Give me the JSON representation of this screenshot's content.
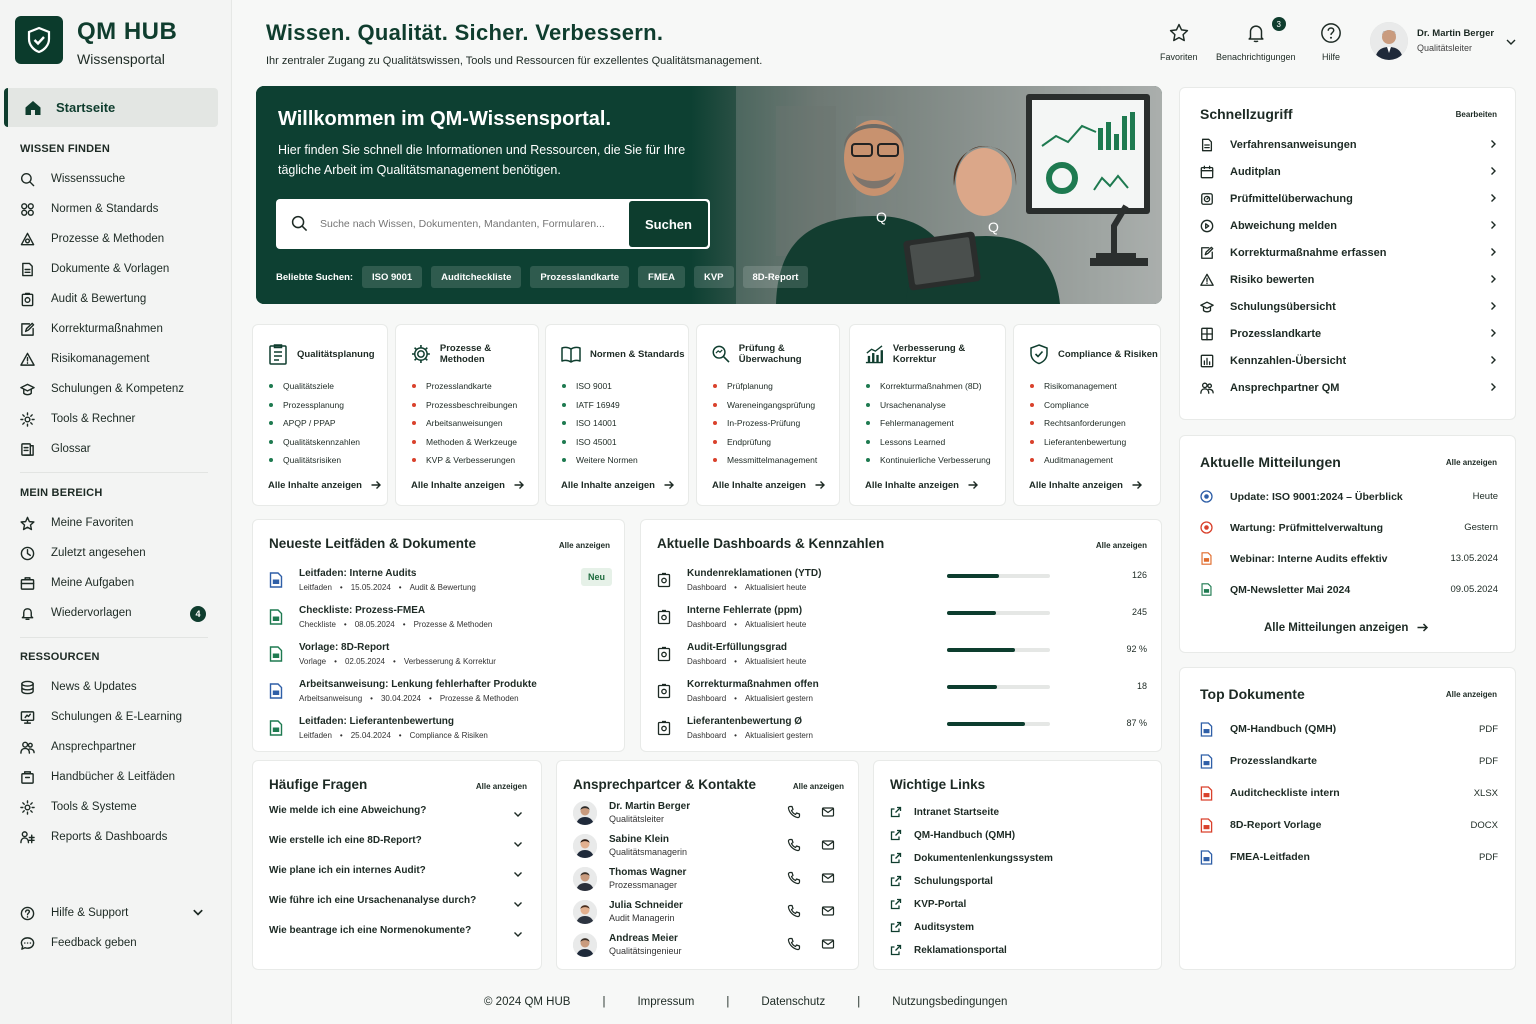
{
  "brand": {
    "title": "QM HUB",
    "subtitle": "Wissensportal"
  },
  "nav": {
    "home": "Startseite",
    "section1": {
      "title": "WISSEN FINDEN",
      "items": [
        {
          "label": "Wissenssuche",
          "icon": "search-icon"
        },
        {
          "label": "Normen & Standards",
          "icon": "grid-icon"
        },
        {
          "label": "Prozesse & Methoden",
          "icon": "process-icon"
        },
        {
          "label": "Dokumente & Vorlagen",
          "icon": "document-icon"
        },
        {
          "label": "Audit & Bewertung",
          "icon": "audit-icon"
        },
        {
          "label": "Korrekturmaßnahmen",
          "icon": "edit-icon"
        },
        {
          "label": "Risikomanagement",
          "icon": "warning-icon"
        },
        {
          "label": "Schulungen & Kompetenz",
          "icon": "training-icon"
        },
        {
          "label": "Tools & Rechner",
          "icon": "tools-icon"
        },
        {
          "label": "Glossar",
          "icon": "glossary-icon"
        }
      ]
    },
    "section2": {
      "title": "MEIN BEREICH",
      "items": [
        {
          "label": "Meine Favoriten",
          "icon": "star-icon"
        },
        {
          "label": "Zuletzt angesehen",
          "icon": "clock-icon"
        },
        {
          "label": "Meine Aufgaben",
          "icon": "tasks-icon"
        },
        {
          "label": "Wiedervorlagen",
          "icon": "bell-icon",
          "badge": "4"
        }
      ]
    },
    "section3": {
      "title": "RESSOURCEN",
      "items": [
        {
          "label": "News & Updates",
          "icon": "news-icon"
        },
        {
          "label": "Schulungen & E-Learning",
          "icon": "elearning-icon"
        },
        {
          "label": "Ansprechpartner",
          "icon": "people-icon"
        },
        {
          "label": "Handbücher & Leitfäden",
          "icon": "book-icon"
        },
        {
          "label": "Tools & Systeme",
          "icon": "tools-icon"
        },
        {
          "label": "Reports & Dashboards",
          "icon": "report-icon"
        }
      ]
    },
    "bottom": [
      {
        "label": "Hilfe & Support",
        "icon": "help-icon"
      },
      {
        "label": "Feedback geben",
        "icon": "chat-icon"
      }
    ]
  },
  "header": {
    "title": "Wissen. Qualität.  Sicher. Verbessern.",
    "subtitle": "Ihr zentraler Zugang zu Qualitätswissen, Tools und Ressourcen für exzellentes Qualitätsmanagement.",
    "favorites": "Favoriten",
    "notifications": "Benachrichtigungen",
    "notifications_count": "3",
    "help": "Hilfe",
    "user_name": "Dr. Martin Berger",
    "user_role": "Qualitätsleiter"
  },
  "hero": {
    "title": "Willkommen im QM-Wissensportal.",
    "text": "Hier finden Sie schnell die Informationen und Ressourcen, die Sie für Ihre tägliche Arbeit im Qualitätsmanagement benötigen.",
    "search_placeholder": "Suche nach Wissen, Dokumenten, Mandanten, Formularen...",
    "search_button": "Suchen",
    "popular_label": "Beliebte Suchen:",
    "popular": [
      "ISO 9001",
      "Auditcheckliste",
      "Prozesslandkarte",
      "FMEA",
      "KVP",
      "8D-Report"
    ]
  },
  "categories": [
    {
      "title": "Qualitätsplanung",
      "items": [
        "Qualitätsziele",
        "Prozessplanung",
        "APQP / PPAP",
        "Qualitätskennzahlen",
        "Qualitätsrisiken"
      ],
      "link": "Alle Inhalte anzeigen"
    },
    {
      "title": "Prozesse & Methoden",
      "items": [
        "Prozesslandkarte",
        "Prozessbeschreibungen",
        "Arbeitsanweisungen",
        "Methoden & Werkzeuge",
        "KVP & Verbesserungen"
      ],
      "link": "Alle Inhalte anzeigen"
    },
    {
      "title": "Normen & Standards",
      "items": [
        "ISO 9001",
        "IATF 16949",
        "ISO 14001",
        "ISO 45001",
        "Weitere Normen"
      ],
      "link": "Alle Inhalte anzeigen"
    },
    {
      "title": "Prüfung & Überwachung",
      "items": [
        "Prüfplanung",
        "Wareneingangsprüfung",
        "In-Prozess-Prüfung",
        "Endprüfung",
        "Messmittelmanagement"
      ],
      "link": "Alle Inhalte anzeigen"
    },
    {
      "title": "Verbesserung & Korrektur",
      "items": [
        "Korrekturmaßnahmen (8D)",
        "Ursachenanalyse",
        "Fehlermanagement",
        "Lessons Learned",
        "Kontinuierliche Verbesserung"
      ],
      "link": "Alle Inhalte anzeigen"
    },
    {
      "title": "Compliance & Risiken",
      "items": [
        "Risikomanagement",
        "Compliance",
        "Rechtsanforderungen",
        "Lieferantenbewertung",
        "Auditmanagement"
      ],
      "link": "Alle Inhalte anzeigen"
    }
  ],
  "docs": {
    "title": "Neueste Leitfäden & Dokumente",
    "link": "Alle anzeigen",
    "badge": "Neu",
    "items": [
      {
        "title": "Leitfaden: Interne Audits",
        "type": "Leitfaden",
        "date": "15.05.2024",
        "category": "Audit & Bewertung"
      },
      {
        "title": "Checkliste: Prozess-FMEA",
        "type": "Checkliste",
        "date": "08.05.2024",
        "category": "Prozesse & Methoden"
      },
      {
        "title": "Vorlage: 8D-Report",
        "type": "Vorlage",
        "date": "02.05.2024",
        "category": "Verbesserung & Korrektur"
      },
      {
        "title": "Arbeitsanweisung: Lenkung fehlerhafter Produkte",
        "type": "Arbeitsanweisung",
        "date": "30.04.2024",
        "category": "Prozesse & Methoden"
      },
      {
        "title": "Leitfaden: Lieferantenbewertung",
        "type": "Leitfaden",
        "date": "25.04.2024",
        "category": "Compliance & Risiken"
      }
    ]
  },
  "dashboards": {
    "title": "Aktuelle Dashboards & Kennzahlen",
    "link": "Alle anzeigen",
    "items": [
      {
        "title": "Kundenreklamationen (YTD)",
        "type": "Dashboard",
        "updated": "Aktualisiert heute",
        "value": "126",
        "progress": 0.5
      },
      {
        "title": "Interne Fehlerrate (ppm)",
        "type": "Dashboard",
        "updated": "Aktualisiert heute",
        "value": "245",
        "progress": 0.48
      },
      {
        "title": "Audit-Erfüllungsgrad",
        "type": "Dashboard",
        "updated": "Aktualisiert heute",
        "value": "92 %",
        "progress": 0.66
      },
      {
        "title": "Korrekturmaßnahmen offen",
        "type": "Dashboard",
        "updated": "Aktualisiert gestern",
        "value": "18",
        "progress": 0.49
      },
      {
        "title": "Lieferantenbewertung Ø",
        "type": "Dashboard",
        "updated": "Aktualisiert gestern",
        "value": "87 %",
        "progress": 0.76
      }
    ]
  },
  "faq": {
    "title": "Häufige Fragen",
    "link": "Alle anzeigen",
    "items": [
      "Wie melde ich eine Abweichung?",
      "Wie erstelle ich eine 8D-Report?",
      "Wie plane ich ein internes Audit?",
      "Wie führe ich eine Ursachenanalyse durch?",
      "Wie beantrage ich eine Normenokumente?"
    ]
  },
  "contacts": {
    "title": "Ansprechpartcer & Kontakte",
    "link": "Alle anzeigen",
    "items": [
      {
        "name": "Dr. Martin Berger",
        "role": "Qualitätsleiter"
      },
      {
        "name": "Sabine Klein",
        "role": "Qualitätsmanagerin"
      },
      {
        "name": "Thomas Wagner",
        "role": "Prozessmanager"
      },
      {
        "name": "Julia Schneider",
        "role": "Audit Managerin"
      },
      {
        "name": "Andreas Meier",
        "role": "Qualitätsingenieur"
      }
    ]
  },
  "links": {
    "title": "Wichtige Links",
    "items": [
      "Intranet Startseite",
      "QM-Handbuch (QMH)",
      "Dokumentenlenkungssystem",
      "Schulungsportal",
      "KVP-Portal",
      "Auditsystem",
      "Reklamationsportal"
    ]
  },
  "quick": {
    "title": "Schnellzugriff",
    "edit": "Bearbeiten",
    "items": [
      {
        "label": "Verfahrensanweisungen",
        "icon": "document-icon"
      },
      {
        "label": "Auditplan",
        "icon": "calendar-icon"
      },
      {
        "label": "Prüfmittelüberwachung",
        "icon": "gauge-icon"
      },
      {
        "label": "Abweichung melden",
        "icon": "alert-circle-icon"
      },
      {
        "label": "Korrekturmaßnahme erfassen",
        "icon": "edit-icon"
      },
      {
        "label": "Risiko bewerten",
        "icon": "warning-icon"
      },
      {
        "label": "Schulungsübersicht",
        "icon": "training-icon"
      },
      {
        "label": "Prozesslandkarte",
        "icon": "map-icon"
      },
      {
        "label": "Kennzahlen-Übersicht",
        "icon": "chart-icon"
      },
      {
        "label": "Ansprechpartner QM",
        "icon": "people-icon"
      }
    ]
  },
  "messages": {
    "title": "Aktuelle Mitteilungen",
    "link": "Alle anzeigen",
    "all_label": "Alle Mitteilungen anzeigen",
    "items": [
      {
        "title": "Update: ISO 9001:2024 – Überblick",
        "date": "Heute",
        "color": "#2f5fa7"
      },
      {
        "title": "Wartung: Prüfmittelverwaltung",
        "date": "Gestern",
        "color": "#d9412c"
      },
      {
        "title": "Webinar: Interne Audits effektiv",
        "date": "13.05.2024",
        "color": "#e06a2a"
      },
      {
        "title": "QM-Newsletter Mai 2024",
        "date": "09.05.2024",
        "color": "#1e7a50"
      }
    ]
  },
  "topdocs": {
    "title": "Top Dokumente",
    "link": "Alle anzeigen",
    "items": [
      {
        "title": "QM-Handbuch (QMH)",
        "type": "PDF",
        "color": "#2f5fa7"
      },
      {
        "title": "Prozesslandkarte",
        "type": "PDF",
        "color": "#2f5fa7"
      },
      {
        "title": "Auditcheckliste intern",
        "type": "XLSX",
        "color": "#d9412c"
      },
      {
        "title": "8D-Report Vorlage",
        "type": "DOCX",
        "color": "#d9412c"
      },
      {
        "title": "FMEA-Leitfaden",
        "type": "PDF",
        "color": "#2f5fa7"
      }
    ]
  },
  "footer": [
    "© 2024 QM HUB",
    "Impressum",
    "Datenschutz",
    "Nutzungsbedingungen"
  ],
  "colors": {
    "brand": "#0f3d2e",
    "accent_green": "#1e7a50",
    "accent_red": "#d9412c",
    "blue": "#2f5fa7"
  }
}
